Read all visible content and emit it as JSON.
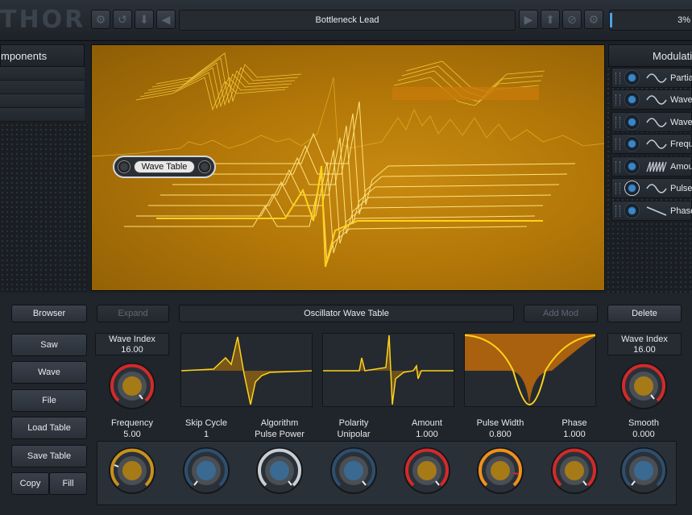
{
  "header": {
    "logo_text": "THOR",
    "patch_name": "Bottleneck Lead",
    "cpu_percent": "3%",
    "left_icons": [
      "gear-icon",
      "undo-icon",
      "download-icon",
      "left-arrow-icon"
    ],
    "right_icons": [
      "play-icon",
      "up-icon",
      "no-icon",
      "gear-icon"
    ]
  },
  "left_panel": {
    "title": "mponents"
  },
  "mod_panel": {
    "title": "Modulatio",
    "items": [
      {
        "label": "Partia",
        "wave": "sine"
      },
      {
        "label": "Wave",
        "wave": "sine"
      },
      {
        "label": "Wave",
        "wave": "sine"
      },
      {
        "label": "Frequ",
        "wave": "sine"
      },
      {
        "label": "Amou",
        "wave": "saw"
      },
      {
        "label": "Pulse",
        "wave": "sine"
      },
      {
        "label": "Phase",
        "wave": "ramp"
      }
    ]
  },
  "display": {
    "tag_label": "Wave Table"
  },
  "toolbar": {
    "browser": "Browser",
    "expand": "Expand",
    "title": "Oscillator Wave Table",
    "add_mod": "Add Mod",
    "delete": "Delete"
  },
  "left_buttons": {
    "saw": "Saw",
    "wave": "Wave",
    "file": "File",
    "load_table": "Load Table",
    "save_table": "Save Table",
    "copy": "Copy",
    "fill": "Fill"
  },
  "wave_index_left": {
    "label": "Wave Index",
    "value": "16.00"
  },
  "wave_index_right": {
    "label": "Wave Index",
    "value": "16.00"
  },
  "params": [
    {
      "name": "Frequency",
      "value": "5.00"
    },
    {
      "name": "Skip Cycle",
      "value": "1"
    },
    {
      "name": "Algorithm",
      "value": "Pulse Power"
    },
    {
      "name": "Polarity",
      "value": "Unipolar"
    },
    {
      "name": "Amount",
      "value": "1.000"
    },
    {
      "name": "Pulse Width",
      "value": "0.800"
    },
    {
      "name": "Phase",
      "value": "1.000"
    },
    {
      "name": "Smooth",
      "value": "0.000"
    }
  ],
  "colors": {
    "accent_blue": "#3a86c8",
    "accent_red": "#d22a2a",
    "accent_orange": "#f0901c",
    "wave_yellow": "#ffd21a",
    "display_amber": "#b27708"
  }
}
